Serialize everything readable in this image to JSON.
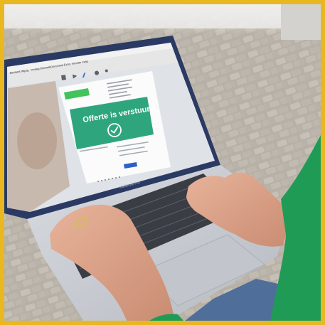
{
  "photo": {
    "frame_color": "#e9b820",
    "pavement_color": "#b9b2a8",
    "laptop_color": "#c9ccd1",
    "sleeve_color": "#1f9b55",
    "jeans_color": "#4f6f9a"
  },
  "screen": {
    "menu_items": [
      "Bestand",
      "Wijzig",
      "Invoeg",
      "Opmaak",
      "Document",
      "Extra",
      "Venster",
      "Help"
    ],
    "toolbar": [
      {
        "icon": "document-icon"
      },
      {
        "icon": "send-icon"
      },
      {
        "icon": "pen-icon"
      },
      {
        "icon": "gear-icon"
      },
      {
        "icon": "user-icon"
      }
    ],
    "document": {
      "green_tag": "",
      "overlay": {
        "message": "Offerte is verstuurd",
        "color": "#2fa57e",
        "icon": "check-circle-icon"
      },
      "button_color": "#2c5fc7"
    },
    "laptop_brand": "MacBook Pro"
  }
}
